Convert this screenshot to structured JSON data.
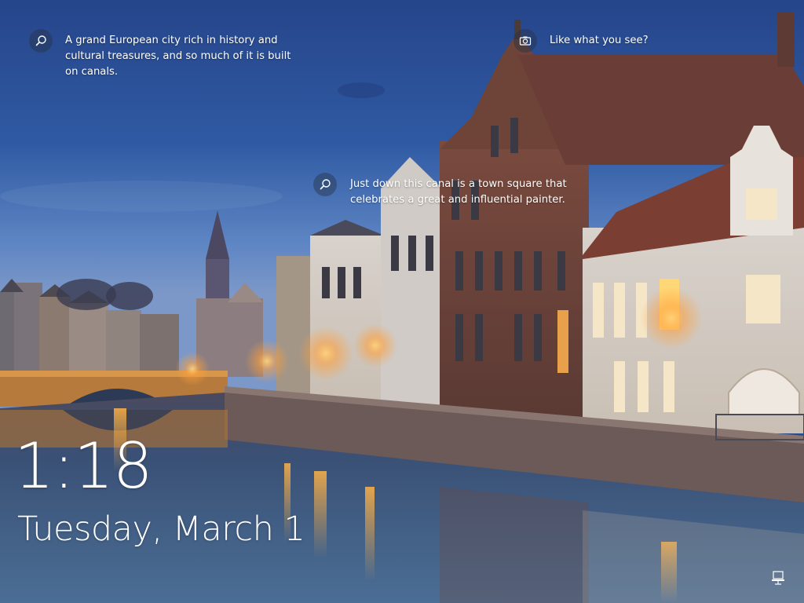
{
  "lock_screen": {
    "time": "1:18",
    "date": "Tuesday, March 1"
  },
  "spotlight": {
    "hotspots": [
      {
        "icon": "search-icon",
        "text": "A grand European city rich in history and cultural treasures, and so much of it is built on canals."
      },
      {
        "icon": "search-icon",
        "text": "Just down this canal is a town square that celebrates a great and influential painter."
      }
    ],
    "feedback": {
      "icon": "camera-icon",
      "text": "Like what you see?"
    }
  },
  "system_tray": {
    "network_icon": "network-icon"
  },
  "colors": {
    "sky_top": "#2a4a8f",
    "sky_horizon": "#6a8fc7",
    "water": "#2c4d77",
    "lamp_glow": "#ffb347",
    "text": "#ffffff"
  }
}
